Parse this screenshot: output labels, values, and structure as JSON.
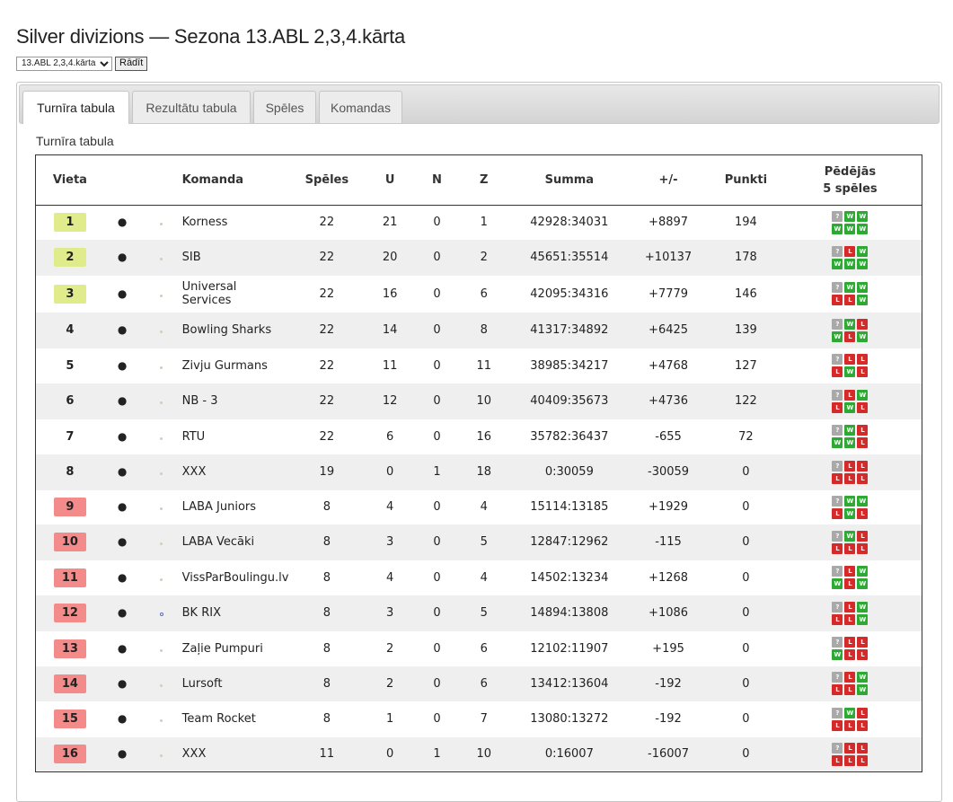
{
  "page": {
    "title": "Silver divizions — Sezona 13.ABL 2,3,4.kārta"
  },
  "season_select": {
    "selected": "13.ABL 2,3,4.kārta",
    "button": "Rādīt"
  },
  "tabs": [
    {
      "label": "Turnīra tabula",
      "active": true
    },
    {
      "label": "Rezultātu tabula",
      "active": false
    },
    {
      "label": "Spēles",
      "active": false
    },
    {
      "label": "Komandas",
      "active": false
    }
  ],
  "section_title": "Turnīra tabula",
  "table": {
    "headers": {
      "place": "Vieta",
      "team": "Komanda",
      "games": "Spēles",
      "wins": "U",
      "draws": "N",
      "losses": "Z",
      "sum": "Summa",
      "diff": "+/-",
      "points": "Punkti",
      "last5_line1": "Pēdējās",
      "last5_line2": "5 spēles"
    },
    "rows": [
      {
        "place": "1",
        "team": "Korness",
        "games": "22",
        "wins": "21",
        "draws": "0",
        "losses": "1",
        "sum": "42928:34031",
        "diff": "+8897",
        "points": "194",
        "last5": [
          "?",
          "W",
          "W",
          "W",
          "W",
          "W"
        ]
      },
      {
        "place": "2",
        "team": "SIB",
        "games": "22",
        "wins": "20",
        "draws": "0",
        "losses": "2",
        "sum": "45651:35514",
        "diff": "+10137",
        "points": "178",
        "last5": [
          "?",
          "L",
          "W",
          "W",
          "W",
          "W"
        ]
      },
      {
        "place": "3",
        "team": "Universal Services",
        "games": "22",
        "wins": "16",
        "draws": "0",
        "losses": "6",
        "sum": "42095:34316",
        "diff": "+7779",
        "points": "146",
        "last5": [
          "?",
          "W",
          "W",
          "L",
          "L",
          "W"
        ]
      },
      {
        "place": "4",
        "team": "Bowling Sharks",
        "games": "22",
        "wins": "14",
        "draws": "0",
        "losses": "8",
        "sum": "41317:34892",
        "diff": "+6425",
        "points": "139",
        "last5": [
          "?",
          "W",
          "L",
          "W",
          "L",
          "W"
        ]
      },
      {
        "place": "5",
        "team": "Zivju Gurmans",
        "games": "22",
        "wins": "11",
        "draws": "0",
        "losses": "11",
        "sum": "38985:34217",
        "diff": "+4768",
        "points": "127",
        "last5": [
          "?",
          "L",
          "L",
          "L",
          "W",
          "L"
        ]
      },
      {
        "place": "6",
        "team": "NB - 3",
        "games": "22",
        "wins": "12",
        "draws": "0",
        "losses": "10",
        "sum": "40409:35673",
        "diff": "+4736",
        "points": "122",
        "last5": [
          "?",
          "L",
          "W",
          "L",
          "W",
          "L"
        ]
      },
      {
        "place": "7",
        "team": "RTU",
        "games": "22",
        "wins": "6",
        "draws": "0",
        "losses": "16",
        "sum": "35782:36437",
        "diff": "-655",
        "points": "72",
        "last5": [
          "?",
          "W",
          "L",
          "W",
          "W",
          "L"
        ]
      },
      {
        "place": "8",
        "team": "XXX",
        "games": "19",
        "wins": "0",
        "draws": "1",
        "losses": "18",
        "sum": "0:30059",
        "diff": "-30059",
        "points": "0",
        "last5": [
          "?",
          "L",
          "L",
          "L",
          "L",
          "L"
        ]
      },
      {
        "place": "9",
        "team": "LABA Juniors",
        "games": "8",
        "wins": "4",
        "draws": "0",
        "losses": "4",
        "sum": "15114:13185",
        "diff": "+1929",
        "points": "0",
        "last5": [
          "?",
          "W",
          "W",
          "L",
          "W",
          "L"
        ]
      },
      {
        "place": "10",
        "team": "LABA Vecāki",
        "games": "8",
        "wins": "3",
        "draws": "0",
        "losses": "5",
        "sum": "12847:12962",
        "diff": "-115",
        "points": "0",
        "last5": [
          "?",
          "W",
          "L",
          "L",
          "L",
          "L"
        ]
      },
      {
        "place": "11",
        "team": "VissParBoulingu.lv",
        "games": "8",
        "wins": "4",
        "draws": "0",
        "losses": "4",
        "sum": "14502:13234",
        "diff": "+1268",
        "points": "0",
        "last5": [
          "?",
          "L",
          "W",
          "W",
          "L",
          "W"
        ]
      },
      {
        "place": "12",
        "team": "BK RIX",
        "games": "8",
        "wins": "3",
        "draws": "0",
        "losses": "5",
        "sum": "14894:13808",
        "diff": "+1086",
        "points": "0",
        "last5": [
          "?",
          "L",
          "W",
          "L",
          "L",
          "W"
        ]
      },
      {
        "place": "13",
        "team": "Zaļie Pumpuri",
        "games": "8",
        "wins": "2",
        "draws": "0",
        "losses": "6",
        "sum": "12102:11907",
        "diff": "+195",
        "points": "0",
        "last5": [
          "?",
          "L",
          "L",
          "W",
          "L",
          "L"
        ]
      },
      {
        "place": "14",
        "team": "Lursoft",
        "games": "8",
        "wins": "2",
        "draws": "0",
        "losses": "6",
        "sum": "13412:13604",
        "diff": "-192",
        "points": "0",
        "last5": [
          "?",
          "L",
          "W",
          "L",
          "L",
          "W"
        ]
      },
      {
        "place": "15",
        "team": "Team Rocket",
        "games": "8",
        "wins": "1",
        "draws": "0",
        "losses": "7",
        "sum": "13080:13272",
        "diff": "-192",
        "points": "0",
        "last5": [
          "?",
          "W",
          "L",
          "L",
          "L",
          "L"
        ]
      },
      {
        "place": "16",
        "team": "XXX",
        "games": "11",
        "wins": "0",
        "draws": "1",
        "losses": "10",
        "sum": "0:16007",
        "diff": "-16007",
        "points": "0",
        "last5": [
          "?",
          "L",
          "L",
          "L",
          "L",
          "L"
        ]
      }
    ]
  },
  "colors": {
    "top_rank": "#e0ec8c",
    "bottom_rank": "#f48b8b",
    "win": "#2eaa34",
    "loss": "#d42a2a",
    "unknown": "#a9a9a9"
  }
}
